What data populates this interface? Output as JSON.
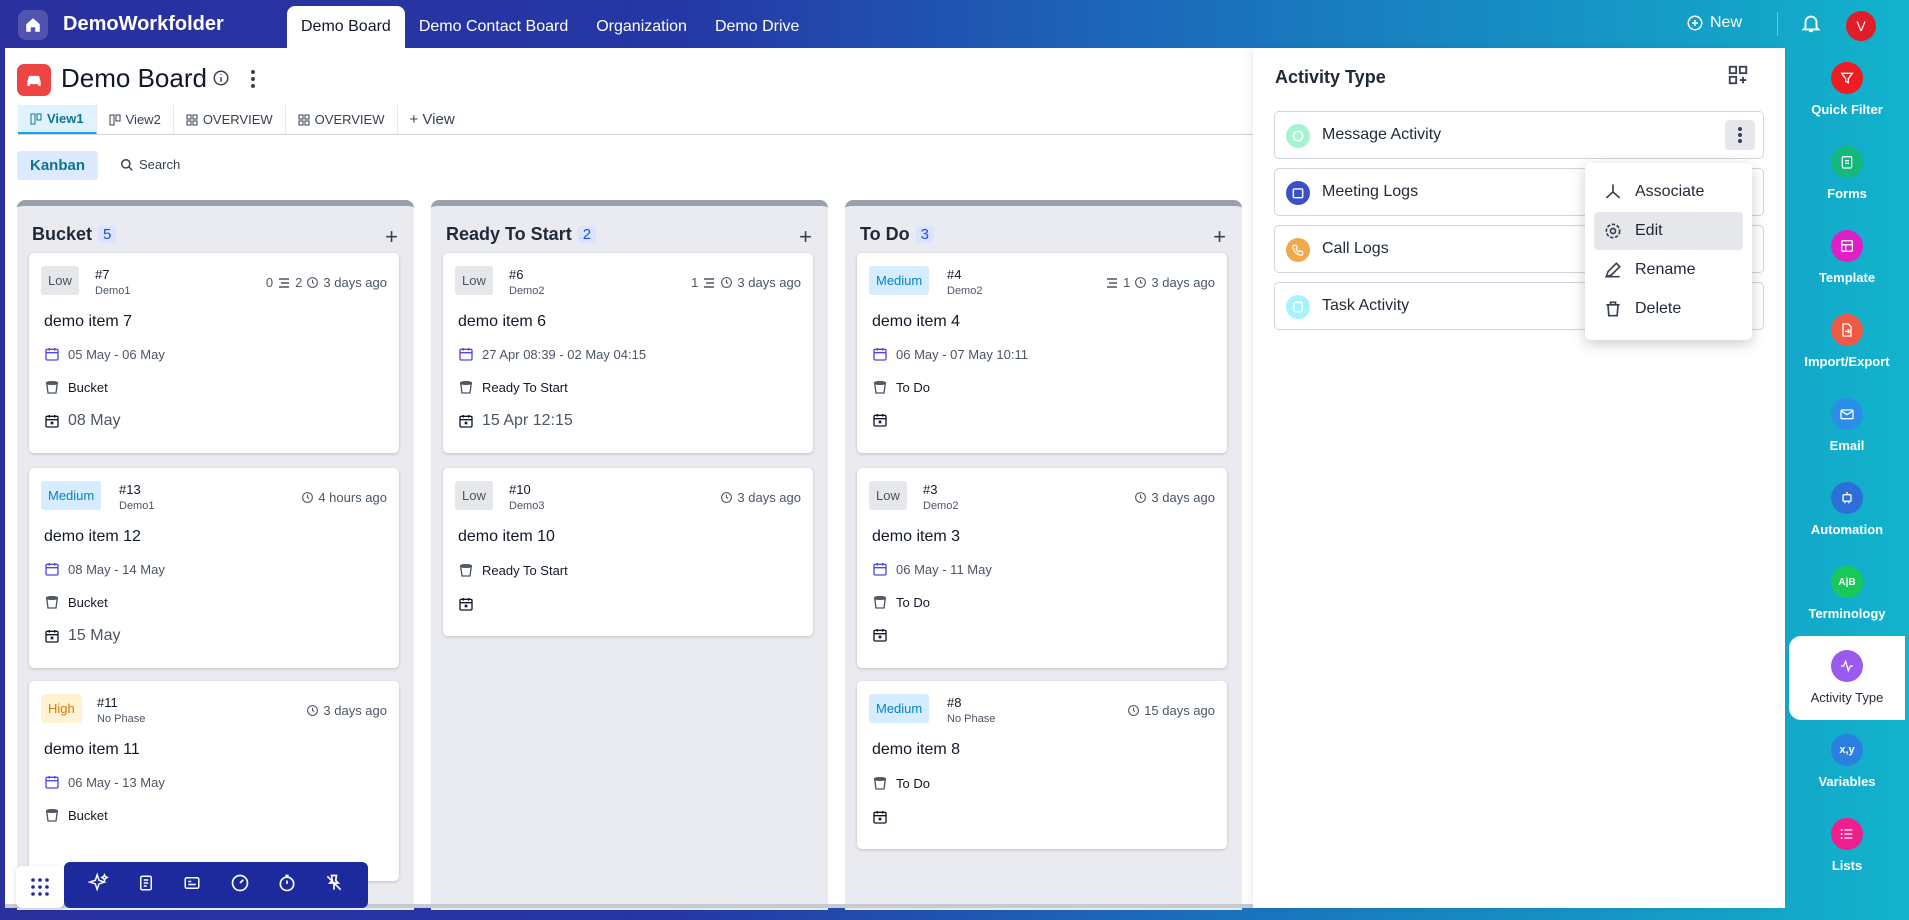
{
  "app": {
    "name": "DemoWorkfolder"
  },
  "nav": {
    "tabs": [
      "Demo Board",
      "Demo Contact Board",
      "Organization",
      "Demo Drive"
    ],
    "new_label": "New",
    "avatar_initial": "V"
  },
  "board": {
    "title": "Demo Board",
    "views": [
      "View1",
      "View2",
      "OVERVIEW",
      "OVERVIEW"
    ],
    "add_view": "+ View",
    "kanban_label": "Kanban",
    "search_label": "Search"
  },
  "columns": [
    {
      "name": "Bucket",
      "count": "5",
      "cards": [
        {
          "priority": "Low",
          "id": "#7",
          "phase": "Demo1",
          "meta_a": "0",
          "meta_b": "2",
          "time": "3 days ago",
          "title": "demo item 7",
          "dates": "05 May  -  06 May",
          "status": "Bucket",
          "due": "08 May"
        },
        {
          "priority": "Medium",
          "id": "#13",
          "phase": "Demo1",
          "time": "4 hours ago",
          "title": "demo item 12",
          "dates": "08 May  -  14 May",
          "status": "Bucket",
          "due": "15 May"
        },
        {
          "priority": "High",
          "id": "#11",
          "phase": "No Phase",
          "time": "3 days ago",
          "title": "demo item 11",
          "dates": "06 May  -  13 May",
          "status": "Bucket"
        }
      ]
    },
    {
      "name": "Ready To Start",
      "count": "2",
      "cards": [
        {
          "priority": "Low",
          "id": "#6",
          "phase": "Demo2",
          "meta_a": "1",
          "time": "3 days ago",
          "title": "demo item 6",
          "dates": "27 Apr 08:39  -  02 May 04:15",
          "status": "Ready To Start",
          "due": "15 Apr 12:15"
        },
        {
          "priority": "Low",
          "id": "#10",
          "phase": "Demo3",
          "time": "3 days ago",
          "title": "demo item 10",
          "status": "Ready To Start"
        }
      ]
    },
    {
      "name": "To Do",
      "count": "3",
      "cards": [
        {
          "priority": "Medium",
          "id": "#4",
          "phase": "Demo2",
          "meta_a": "1",
          "time": "3 days ago",
          "title": "demo item 4",
          "dates": "06 May  -  07 May 10:11",
          "status": "To Do"
        },
        {
          "priority": "Low",
          "id": "#3",
          "phase": "Demo2",
          "time": "3 days ago",
          "title": "demo item 3",
          "dates": "06 May  -  11 May",
          "status": "To Do"
        },
        {
          "priority": "Medium",
          "id": "#8",
          "phase": "No Phase",
          "time": "15 days ago",
          "title": "demo item 8",
          "status": "To Do"
        }
      ]
    }
  ],
  "panel": {
    "title": "Activity Type",
    "activities": [
      "Message Activity",
      "Meeting Logs",
      "Call Logs",
      "Task Activity"
    ],
    "menu": [
      "Associate",
      "Edit",
      "Rename",
      "Delete"
    ]
  },
  "sidebar": {
    "items": [
      "Quick Filter",
      "Forms",
      "Template",
      "Import/Export",
      "Email",
      "Automation",
      "Terminology",
      "Activity Type",
      "Variables",
      "Lists"
    ],
    "terminology_badge": "A|B",
    "variables_badge": "x,y"
  },
  "colors": {
    "accent": "#0ea5e9",
    "brand_bar_start": "#2a2f9e",
    "brand_bar_end": "#12b3cc"
  }
}
